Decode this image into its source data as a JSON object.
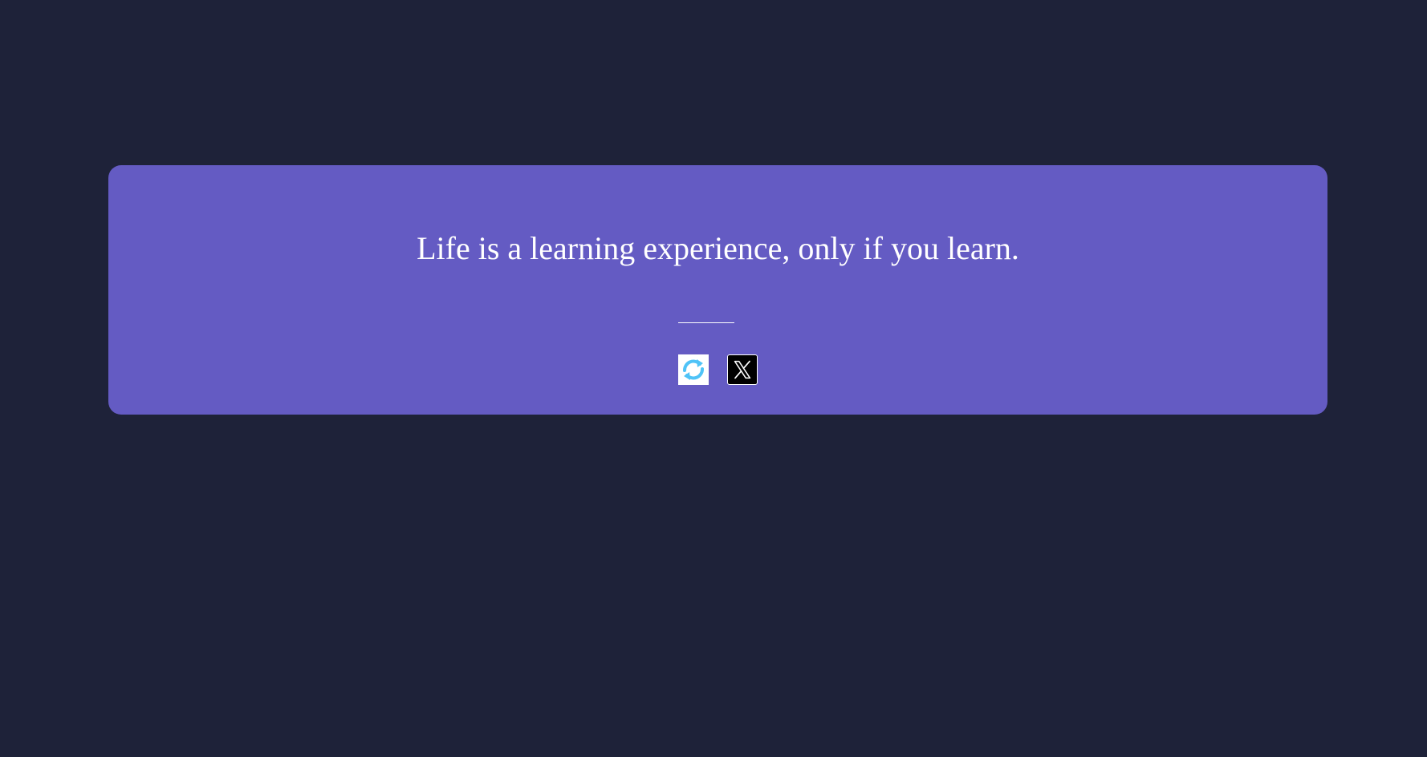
{
  "quote": {
    "text": "Life is a learning experience, only if you learn."
  },
  "actions": {
    "refresh": {
      "icon": "refresh-icon",
      "color": "#4fc3f7"
    },
    "tweet": {
      "icon": "x-logo-icon",
      "color": "#000000"
    }
  },
  "colors": {
    "background": "#1e2239",
    "card": "#645bc3",
    "text": "#ffffff"
  }
}
